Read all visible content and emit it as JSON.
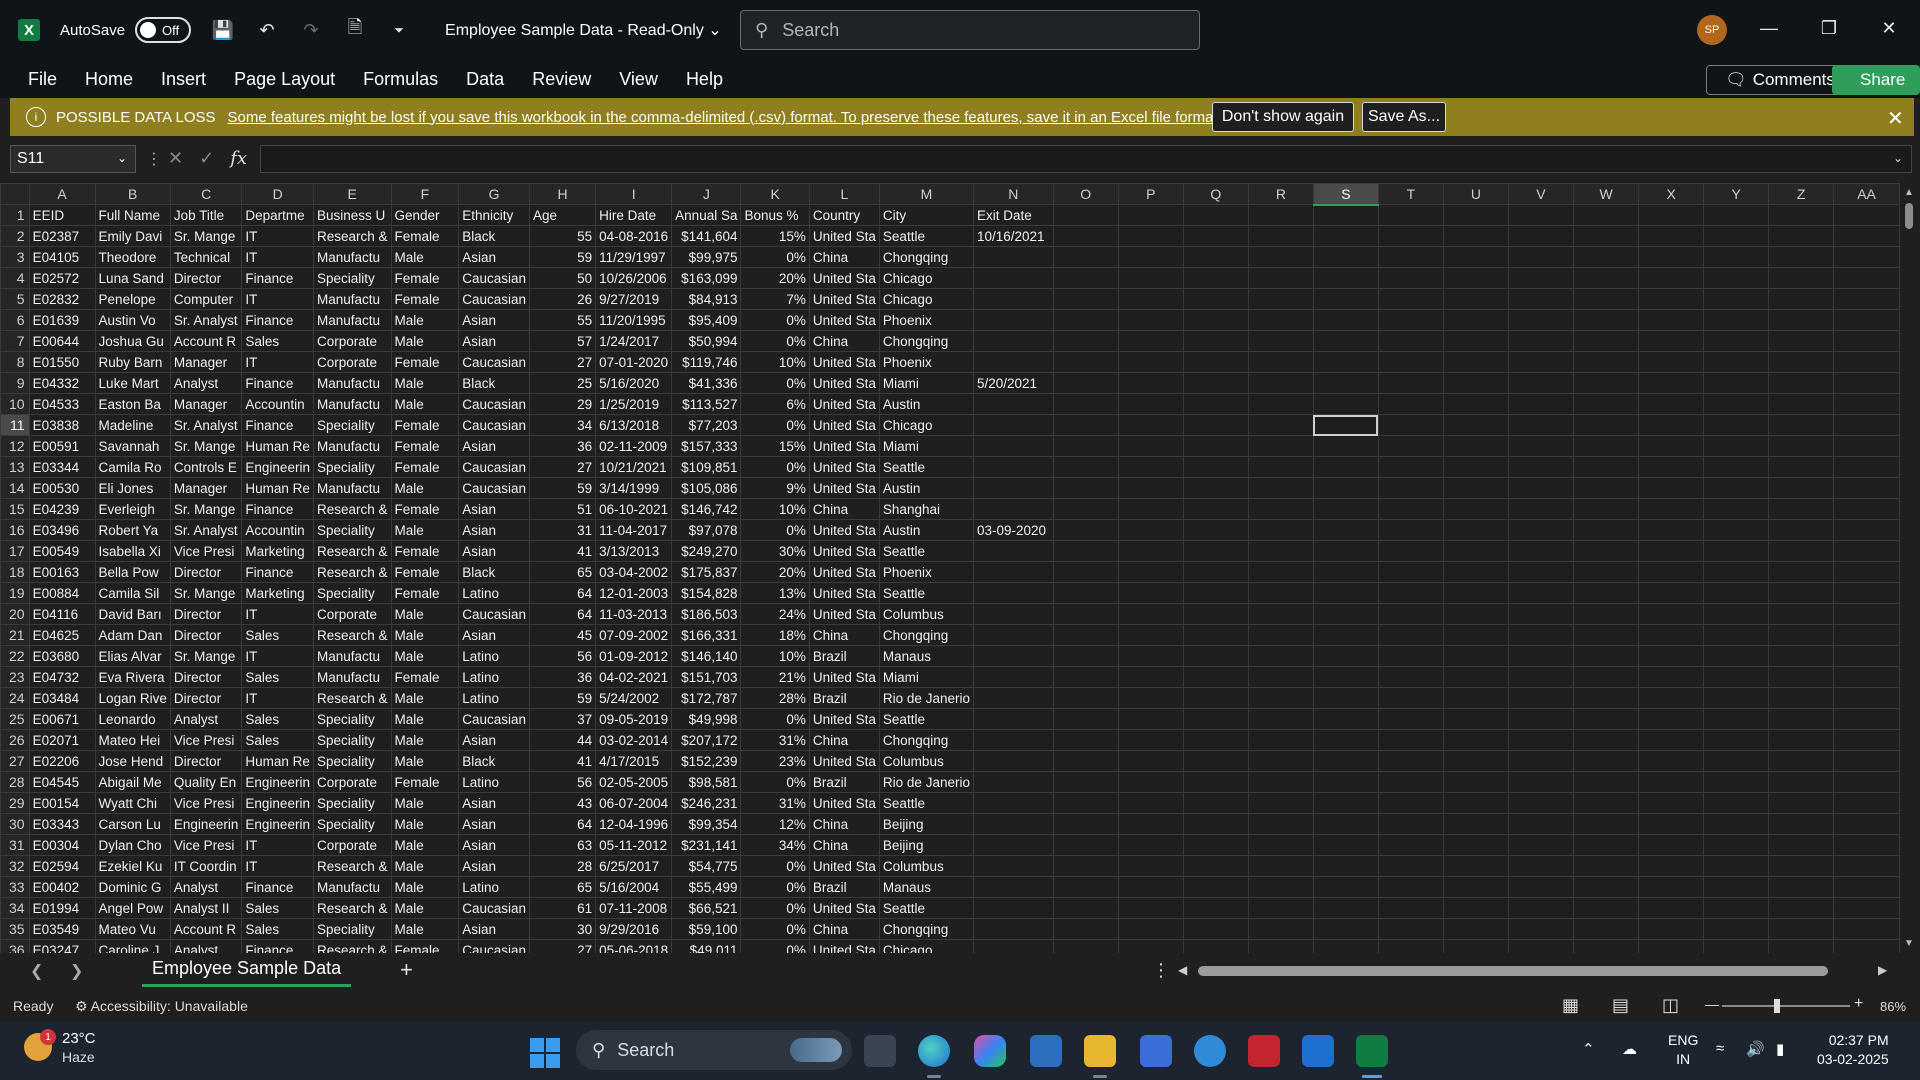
{
  "window": {
    "autosave_label": "AutoSave",
    "autosave_state": "Off",
    "doc_title": "Employee Sample Data  -  Read-Only",
    "search_placeholder": "Search",
    "avatar_initials": "SP"
  },
  "menu": [
    "File",
    "Home",
    "Insert",
    "Page Layout",
    "Formulas",
    "Data",
    "Review",
    "View",
    "Help"
  ],
  "actions": {
    "comments": "Comments",
    "share": "Share"
  },
  "warning": {
    "title": "POSSIBLE DATA LOSS",
    "message": "Some features might be lost if you save this workbook in the comma-delimited (.csv) format. To preserve these features, save it in an Excel file format.",
    "dont_show": "Don't show again",
    "save_as": "Save As..."
  },
  "formula_bar": {
    "name_box": "S11",
    "formula": ""
  },
  "columns": [
    {
      "letter": "A"
    },
    {
      "letter": "B"
    },
    {
      "letter": "C"
    },
    {
      "letter": "D"
    },
    {
      "letter": "E"
    },
    {
      "letter": "F"
    },
    {
      "letter": "G"
    },
    {
      "letter": "H"
    },
    {
      "letter": "I"
    },
    {
      "letter": "J"
    },
    {
      "letter": "K"
    },
    {
      "letter": "L"
    },
    {
      "letter": "M"
    },
    {
      "letter": "N"
    },
    {
      "letter": "O"
    },
    {
      "letter": "P"
    },
    {
      "letter": "Q"
    },
    {
      "letter": "R"
    },
    {
      "letter": "S"
    },
    {
      "letter": "T"
    },
    {
      "letter": "U"
    },
    {
      "letter": "V"
    },
    {
      "letter": "W"
    },
    {
      "letter": "X"
    },
    {
      "letter": "Y"
    },
    {
      "letter": "Z"
    },
    {
      "letter": "AA"
    }
  ],
  "selected_column": "S",
  "selected_row": 11,
  "header_row": [
    "EEID",
    "Full Name",
    "Job Title",
    "Departme",
    "Business U",
    "Gender",
    "Ethnicity",
    "Age",
    "Hire Date",
    "Annual Sa",
    "Bonus %",
    "Country",
    "City",
    "Exit Date"
  ],
  "rows": [
    [
      "E02387",
      "Emily Davi",
      "Sr. Mange",
      "IT",
      "Research &",
      "Female",
      "Black",
      "55",
      "04-08-2016",
      "$141,604",
      "15%",
      "United Sta",
      "Seattle",
      "10/16/2021"
    ],
    [
      "E04105",
      "Theodore",
      "Technical",
      "IT",
      "Manufactu",
      "Male",
      "Asian",
      "59",
      "11/29/1997",
      "$99,975",
      "0%",
      "China",
      "Chongqing",
      ""
    ],
    [
      "E02572",
      "Luna Sand",
      "Director",
      "Finance",
      "Speciality",
      "Female",
      "Caucasian",
      "50",
      "10/26/2006",
      "$163,099",
      "20%",
      "United Sta",
      "Chicago",
      ""
    ],
    [
      "E02832",
      "Penelope",
      "Computer",
      "IT",
      "Manufactu",
      "Female",
      "Caucasian",
      "26",
      "9/27/2019",
      "$84,913",
      "7%",
      "United Sta",
      "Chicago",
      ""
    ],
    [
      "E01639",
      "Austin Vo",
      "Sr. Analyst",
      "Finance",
      "Manufactu",
      "Male",
      "Asian",
      "55",
      "11/20/1995",
      "$95,409",
      "0%",
      "United Sta",
      "Phoenix",
      ""
    ],
    [
      "E00644",
      "Joshua Gu",
      "Account R",
      "Sales",
      "Corporate",
      "Male",
      "Asian",
      "57",
      "1/24/2017",
      "$50,994",
      "0%",
      "China",
      "Chongqing",
      ""
    ],
    [
      "E01550",
      "Ruby Barn",
      "Manager",
      "IT",
      "Corporate",
      "Female",
      "Caucasian",
      "27",
      "07-01-2020",
      "$119,746",
      "10%",
      "United Sta",
      "Phoenix",
      ""
    ],
    [
      "E04332",
      "Luke Mart",
      "Analyst",
      "Finance",
      "Manufactu",
      "Male",
      "Black",
      "25",
      "5/16/2020",
      "$41,336",
      "0%",
      "United Sta",
      "Miami",
      "5/20/2021"
    ],
    [
      "E04533",
      "Easton Ba",
      "Manager",
      "Accountin",
      "Manufactu",
      "Male",
      "Caucasian",
      "29",
      "1/25/2019",
      "$113,527",
      "6%",
      "United Sta",
      "Austin",
      ""
    ],
    [
      "E03838",
      "Madeline",
      "Sr. Analyst",
      "Finance",
      "Speciality",
      "Female",
      "Caucasian",
      "34",
      "6/13/2018",
      "$77,203",
      "0%",
      "United Sta",
      "Chicago",
      ""
    ],
    [
      "E00591",
      "Savannah",
      "Sr. Mange",
      "Human Re",
      "Manufactu",
      "Female",
      "Asian",
      "36",
      "02-11-2009",
      "$157,333",
      "15%",
      "United Sta",
      "Miami",
      ""
    ],
    [
      "E03344",
      "Camila Ro",
      "Controls E",
      "Engineerin",
      "Speciality",
      "Female",
      "Caucasian",
      "27",
      "10/21/2021",
      "$109,851",
      "0%",
      "United Sta",
      "Seattle",
      ""
    ],
    [
      "E00530",
      "Eli Jones",
      "Manager",
      "Human Re",
      "Manufactu",
      "Male",
      "Caucasian",
      "59",
      "3/14/1999",
      "$105,086",
      "9%",
      "United Sta",
      "Austin",
      ""
    ],
    [
      "E04239",
      "Everleigh",
      "Sr. Mange",
      "Finance",
      "Research &",
      "Female",
      "Asian",
      "51",
      "06-10-2021",
      "$146,742",
      "10%",
      "China",
      "Shanghai",
      ""
    ],
    [
      "E03496",
      "Robert Ya",
      "Sr. Analyst",
      "Accountin",
      "Speciality",
      "Male",
      "Asian",
      "31",
      "11-04-2017",
      "$97,078",
      "0%",
      "United Sta",
      "Austin",
      "03-09-2020"
    ],
    [
      "E00549",
      "Isabella Xi",
      "Vice Presi",
      "Marketing",
      "Research &",
      "Female",
      "Asian",
      "41",
      "3/13/2013",
      "$249,270",
      "30%",
      "United Sta",
      "Seattle",
      ""
    ],
    [
      "E00163",
      "Bella Pow",
      "Director",
      "Finance",
      "Research &",
      "Female",
      "Black",
      "65",
      "03-04-2002",
      "$175,837",
      "20%",
      "United Sta",
      "Phoenix",
      ""
    ],
    [
      "E00884",
      "Camila Sil",
      "Sr. Mange",
      "Marketing",
      "Speciality",
      "Female",
      "Latino",
      "64",
      "12-01-2003",
      "$154,828",
      "13%",
      "United Sta",
      "Seattle",
      ""
    ],
    [
      "E04116",
      "David Barı",
      "Director",
      "IT",
      "Corporate",
      "Male",
      "Caucasian",
      "64",
      "11-03-2013",
      "$186,503",
      "24%",
      "United Sta",
      "Columbus",
      ""
    ],
    [
      "E04625",
      "Adam Dan",
      "Director",
      "Sales",
      "Research &",
      "Male",
      "Asian",
      "45",
      "07-09-2002",
      "$166,331",
      "18%",
      "China",
      "Chongqing",
      ""
    ],
    [
      "E03680",
      "Elias Alvar",
      "Sr. Mange",
      "IT",
      "Manufactu",
      "Male",
      "Latino",
      "56",
      "01-09-2012",
      "$146,140",
      "10%",
      "Brazil",
      "Manaus",
      ""
    ],
    [
      "E04732",
      "Eva Rivera",
      "Director",
      "Sales",
      "Manufactu",
      "Female",
      "Latino",
      "36",
      "04-02-2021",
      "$151,703",
      "21%",
      "United Sta",
      "Miami",
      ""
    ],
    [
      "E03484",
      "Logan Rive",
      "Director",
      "IT",
      "Research &",
      "Male",
      "Latino",
      "59",
      "5/24/2002",
      "$172,787",
      "28%",
      "Brazil",
      "Rio de Janerio",
      ""
    ],
    [
      "E00671",
      "Leonardo",
      "Analyst",
      "Sales",
      "Speciality",
      "Male",
      "Caucasian",
      "37",
      "09-05-2019",
      "$49,998",
      "0%",
      "United Sta",
      "Seattle",
      ""
    ],
    [
      "E02071",
      "Mateo Hei",
      "Vice Presi",
      "Sales",
      "Speciality",
      "Male",
      "Asian",
      "44",
      "03-02-2014",
      "$207,172",
      "31%",
      "China",
      "Chongqing",
      ""
    ],
    [
      "E02206",
      "Jose Hend",
      "Director",
      "Human Re",
      "Speciality",
      "Male",
      "Black",
      "41",
      "4/17/2015",
      "$152,239",
      "23%",
      "United Sta",
      "Columbus",
      ""
    ],
    [
      "E04545",
      "Abigail Me",
      "Quality En",
      "Engineerin",
      "Corporate",
      "Female",
      "Latino",
      "56",
      "02-05-2005",
      "$98,581",
      "0%",
      "Brazil",
      "Rio de Janerio",
      ""
    ],
    [
      "E00154",
      "Wyatt Chi",
      "Vice Presi",
      "Engineerin",
      "Speciality",
      "Male",
      "Asian",
      "43",
      "06-07-2004",
      "$246,231",
      "31%",
      "United Sta",
      "Seattle",
      ""
    ],
    [
      "E03343",
      "Carson Lu",
      "Engineerin",
      "Engineerin",
      "Speciality",
      "Male",
      "Asian",
      "64",
      "12-04-1996",
      "$99,354",
      "12%",
      "China",
      "Beijing",
      ""
    ],
    [
      "E00304",
      "Dylan Cho",
      "Vice Presi",
      "IT",
      "Corporate",
      "Male",
      "Asian",
      "63",
      "05-11-2012",
      "$231,141",
      "34%",
      "China",
      "Beijing",
      ""
    ],
    [
      "E02594",
      "Ezekiel Ku",
      "IT Coordin",
      "IT",
      "Research &",
      "Male",
      "Asian",
      "28",
      "6/25/2017",
      "$54,775",
      "0%",
      "United Sta",
      "Columbus",
      ""
    ],
    [
      "E00402",
      "Dominic G",
      "Analyst",
      "Finance",
      "Manufactu",
      "Male",
      "Latino",
      "65",
      "5/16/2004",
      "$55,499",
      "0%",
      "Brazil",
      "Manaus",
      ""
    ],
    [
      "E01994",
      "Angel Pow",
      "Analyst II",
      "Sales",
      "Research &",
      "Male",
      "Caucasian",
      "61",
      "07-11-2008",
      "$66,521",
      "0%",
      "United Sta",
      "Seattle",
      ""
    ],
    [
      "E03549",
      "Mateo Vu",
      "Account R",
      "Sales",
      "Speciality",
      "Male",
      "Asian",
      "30",
      "9/29/2016",
      "$59,100",
      "0%",
      "China",
      "Chongqing",
      ""
    ],
    [
      "E03247",
      "Caroline J",
      "Analyst",
      "Finance",
      "Research &",
      "Female",
      "Caucasian",
      "27",
      "05-06-2018",
      "$49,011",
      "0%",
      "United Sta",
      "Chicago",
      ""
    ]
  ],
  "sheet_tabs": [
    "Employee Sample Data"
  ],
  "status": {
    "ready": "Ready",
    "accessibility": "Accessibility: Unavailable",
    "zoom": "86%",
    "zoom_level": 0.43
  },
  "taskbar": {
    "temperature": "23°C",
    "condition": "Haze",
    "weather_badge": "1",
    "search_label": "Search",
    "lang_top": "ENG",
    "lang_bottom": "IN",
    "time": "02:37 PM",
    "date": "03-02-2025"
  }
}
